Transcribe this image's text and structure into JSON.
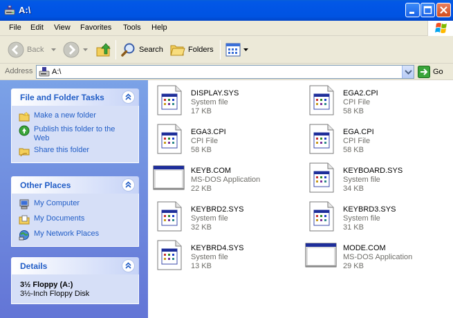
{
  "window": {
    "title": "A:\\"
  },
  "menu": [
    "File",
    "Edit",
    "View",
    "Favorites",
    "Tools",
    "Help"
  ],
  "toolbar": {
    "back_label": "Back",
    "search_label": "Search",
    "folders_label": "Folders"
  },
  "address": {
    "label": "Address",
    "value": "A:\\",
    "go_label": "Go"
  },
  "tasks_panel": {
    "title": "File and Folder Tasks",
    "items": [
      {
        "label": "Make a new folder",
        "icon": "new-folder-icon"
      },
      {
        "label": "Publish this folder to the Web",
        "icon": "publish-web-icon"
      },
      {
        "label": "Share this folder",
        "icon": "share-folder-icon"
      }
    ]
  },
  "places_panel": {
    "title": "Other Places",
    "items": [
      {
        "label": "My Computer",
        "icon": "my-computer-icon"
      },
      {
        "label": "My Documents",
        "icon": "my-documents-icon"
      },
      {
        "label": "My Network Places",
        "icon": "network-places-icon"
      }
    ]
  },
  "details_panel": {
    "title": "Details",
    "name": "3½ Floppy (A:)",
    "type": "3½-Inch Floppy Disk"
  },
  "files": [
    {
      "name": "DISPLAY.SYS",
      "type": "System file",
      "size": "17 KB",
      "icon": "system-file-icon"
    },
    {
      "name": "EGA2.CPI",
      "type": "CPI File",
      "size": "58 KB",
      "icon": "system-file-icon"
    },
    {
      "name": "EGA3.CPI",
      "type": "CPI File",
      "size": "58 KB",
      "icon": "system-file-icon"
    },
    {
      "name": "EGA.CPI",
      "type": "CPI File",
      "size": "58 KB",
      "icon": "system-file-icon"
    },
    {
      "name": "KEYB.COM",
      "type": "MS-DOS Application",
      "size": "22 KB",
      "icon": "dos-application-icon"
    },
    {
      "name": "KEYBOARD.SYS",
      "type": "System file",
      "size": "34 KB",
      "icon": "system-file-icon"
    },
    {
      "name": "KEYBRD2.SYS",
      "type": "System file",
      "size": "32 KB",
      "icon": "system-file-icon"
    },
    {
      "name": "KEYBRD3.SYS",
      "type": "System file",
      "size": "31 KB",
      "icon": "system-file-icon"
    },
    {
      "name": "KEYBRD4.SYS",
      "type": "System file",
      "size": "13 KB",
      "icon": "system-file-icon"
    },
    {
      "name": "MODE.COM",
      "type": "MS-DOS Application",
      "size": "29 KB",
      "icon": "dos-application-icon"
    }
  ]
}
